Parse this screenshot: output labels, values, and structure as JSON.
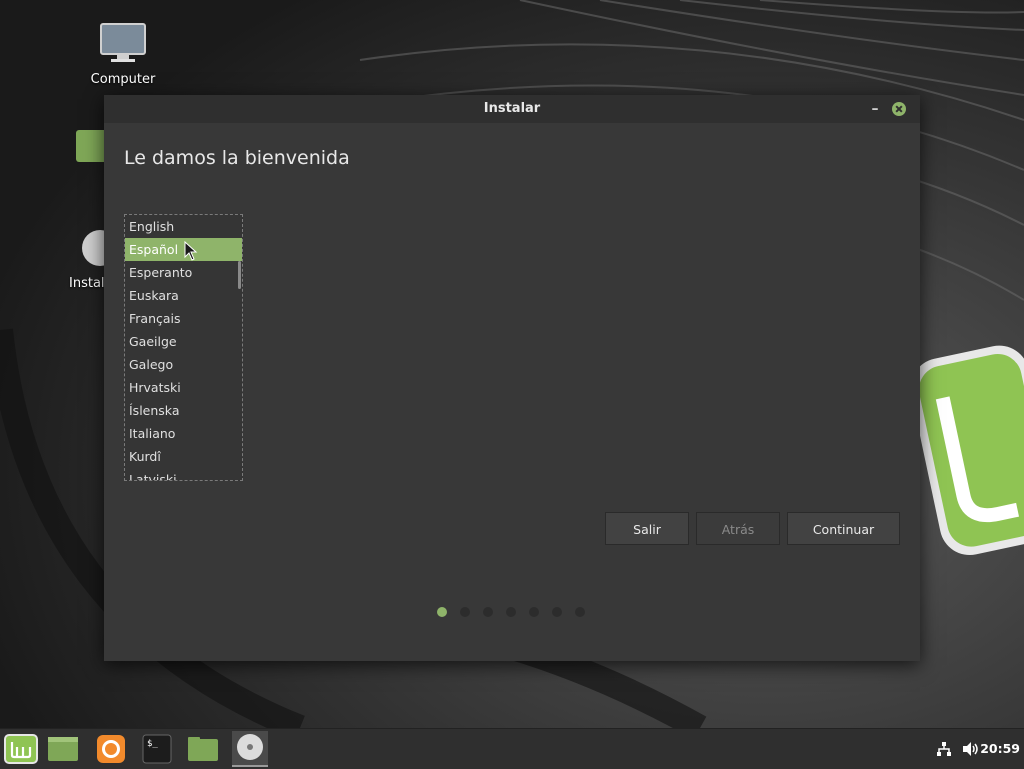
{
  "desktop": {
    "icons": [
      {
        "label": "Computer",
        "icon": "monitor-icon"
      },
      {
        "label": "",
        "icon": "home-folder-icon"
      },
      {
        "label": "Instal",
        "icon": "install-disc-icon"
      }
    ]
  },
  "window": {
    "title": "Instalar",
    "minimize_glyph": "–",
    "heading": "Le damos la bienvenida",
    "languages": [
      {
        "label": "English",
        "selected": false
      },
      {
        "label": "Español",
        "selected": true
      },
      {
        "label": "Esperanto",
        "selected": false
      },
      {
        "label": "Euskara",
        "selected": false
      },
      {
        "label": "Français",
        "selected": false
      },
      {
        "label": "Gaeilge",
        "selected": false
      },
      {
        "label": "Galego",
        "selected": false
      },
      {
        "label": "Hrvatski",
        "selected": false
      },
      {
        "label": "Íslenska",
        "selected": false
      },
      {
        "label": "Italiano",
        "selected": false
      },
      {
        "label": "Kurdî",
        "selected": false
      },
      {
        "label": "Latviski",
        "selected": false
      }
    ],
    "buttons": {
      "quit": "Salir",
      "back": "Atrás",
      "continue": "Continuar"
    },
    "progress": {
      "total_steps": 7,
      "current_step": 1
    }
  },
  "taskbar": {
    "items": [
      {
        "icon": "mint-menu-icon"
      },
      {
        "icon": "show-desktop-icon"
      },
      {
        "icon": "firefox-icon"
      },
      {
        "icon": "terminal-icon"
      },
      {
        "icon": "files-icon"
      },
      {
        "icon": "installer-disc-icon",
        "active": true
      }
    ],
    "tray": [
      "network-icon",
      "volume-icon"
    ],
    "clock": "20:59"
  },
  "colors": {
    "accent": "#8fb46a",
    "window_bg": "#383838",
    "titlebar_bg": "#2f2f2f"
  }
}
